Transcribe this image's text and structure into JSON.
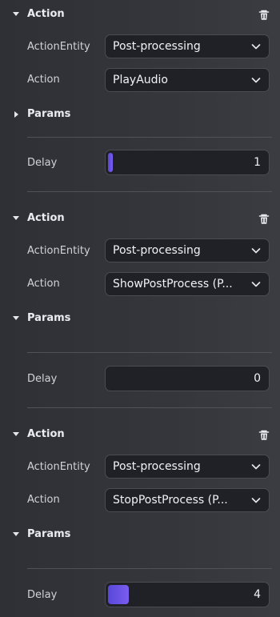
{
  "actions": [
    {
      "header": "Action",
      "expanded": true,
      "entity_label": "ActionEntity",
      "entity_value": "Post-processing",
      "action_label": "Action",
      "action_value": "PlayAudio",
      "params_label": "Params",
      "params_expanded": false,
      "delay_label": "Delay",
      "delay_value": "1",
      "delay_fill_fraction": 0.02
    },
    {
      "header": "Action",
      "expanded": true,
      "entity_label": "ActionEntity",
      "entity_value": "Post-processing",
      "action_label": "Action",
      "action_value": "ShowPostProcess (P...",
      "params_label": "Params",
      "params_expanded": true,
      "delay_label": "Delay",
      "delay_value": "0",
      "delay_fill_fraction": 0
    },
    {
      "header": "Action",
      "expanded": true,
      "entity_label": "ActionEntity",
      "entity_value": "Post-processing",
      "action_label": "Action",
      "action_value": "StopPostProcess (P...",
      "params_label": "Params",
      "params_expanded": true,
      "delay_label": "Delay",
      "delay_value": "4",
      "delay_fill_fraction": 0.1
    }
  ],
  "icons": {
    "collapse": "caret-down-icon",
    "expand": "caret-right-icon",
    "delete": "trash-icon",
    "dropdown": "chevron-down-icon"
  },
  "colors": {
    "accent": "#6a50e8",
    "field_bg": "#202126",
    "panel_bg": "#33353b"
  }
}
